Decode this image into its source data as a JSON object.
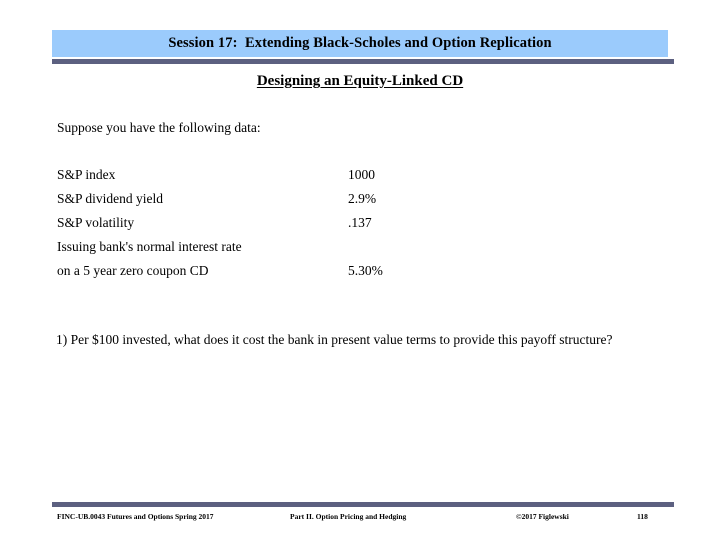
{
  "slide": {
    "title": "Session 17:  Extending Black-Scholes and Option Replication",
    "subtitle": "Designing an Equity-Linked CD",
    "intro": "Suppose you have the following data:",
    "data_rows": [
      {
        "label": "S&P index",
        "value": "1000"
      },
      {
        "label": "S&P dividend yield",
        "value": "2.9%"
      },
      {
        "label": "S&P volatility",
        "value": ".137"
      },
      {
        "label": "Issuing bank's normal interest rate",
        "value": ""
      },
      {
        "label": "on a 5 year zero coupon CD",
        "value": "5.30%"
      }
    ],
    "question": "1)  Per $100 invested, what does it cost the bank in present value terms to provide this payoff structure?"
  },
  "footer": {
    "course": "FINC-UB.0043  Futures and Options   Spring 2017",
    "section": "Part II. Option Pricing and Hedging",
    "copyright": "©2017 Figlewski",
    "page": "118"
  },
  "colors": {
    "banner_fill": "#9BCBFC",
    "rule": "#5C6080",
    "text": "#000000",
    "background": "#FFFFFF"
  }
}
